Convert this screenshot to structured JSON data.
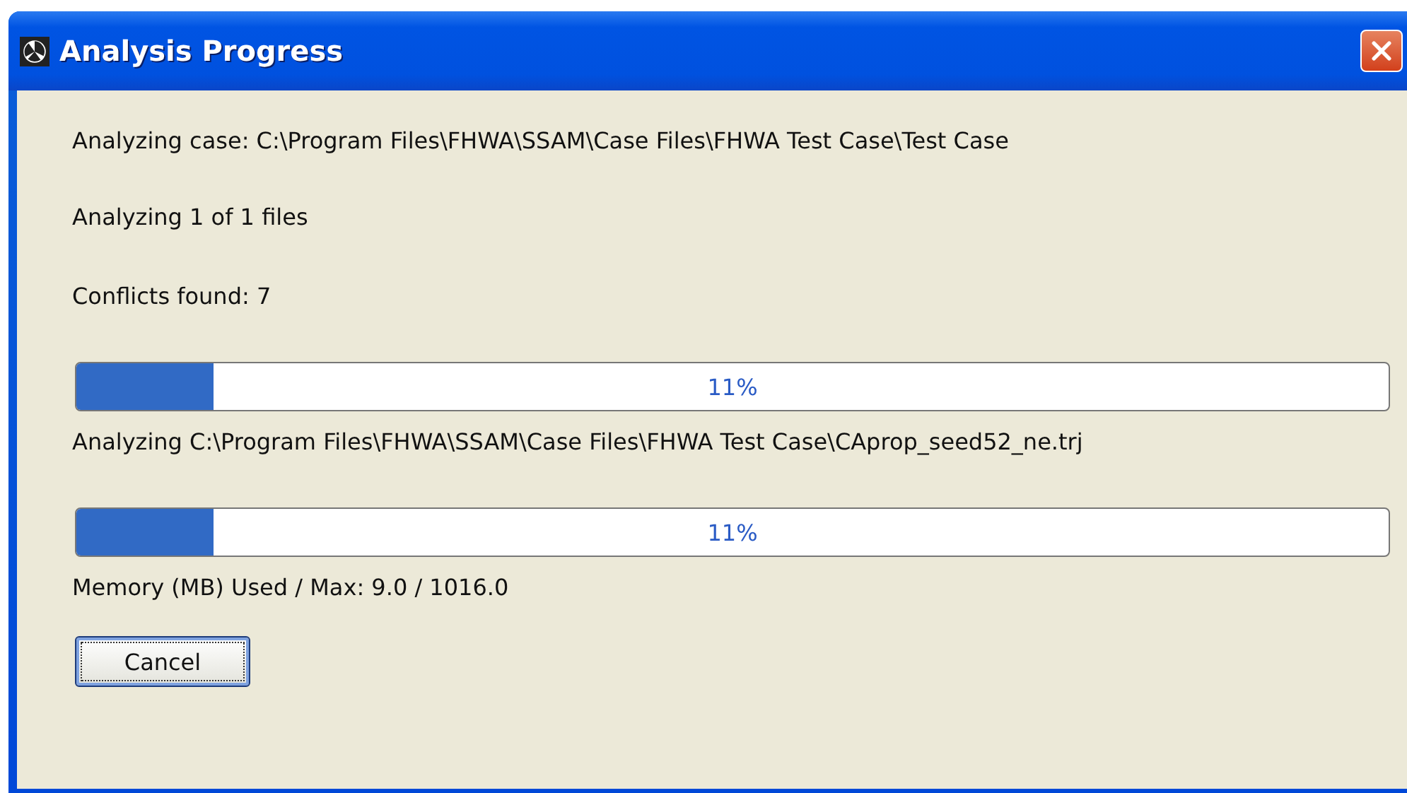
{
  "window": {
    "title": "Analysis Progress"
  },
  "items": [
    {
      "kind": "text",
      "text": "Analyzing case: C:\\Program Files\\FHWA\\SSAM\\Case Files\\FHWA Test Case\\Test Case"
    },
    {
      "kind": "text",
      "text": "Analyzing 1 of 1 files"
    },
    {
      "kind": "text",
      "text": "Conflicts found: 7"
    },
    {
      "kind": "progress",
      "level": 0.105,
      "reading": "11%"
    },
    {
      "kind": "text",
      "text": "Analyzing C:\\Program Files\\FHWA\\SSAM\\Case Files\\FHWA Test Case\\CAprop_seed52_ne.trj"
    },
    {
      "kind": "progress",
      "level": 0.105,
      "reading": "11%"
    },
    {
      "kind": "text",
      "text": "Memory (MB) Used / Max: 9.0 / 1016.0"
    }
  ],
  "buttons": [
    {
      "label": "Cancel",
      "focused": true
    }
  ]
}
